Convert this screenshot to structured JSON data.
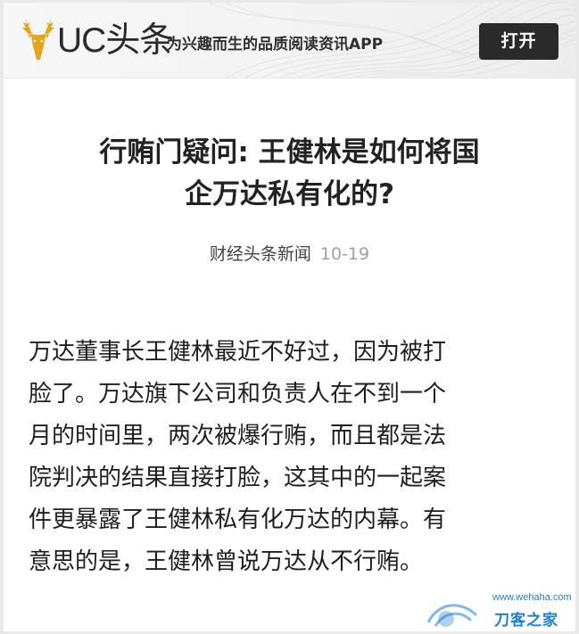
{
  "header": {
    "logo_text": "UC头条",
    "slogan": "为兴趣而生的品质阅读资讯APP",
    "open_label": "打开",
    "logo_icon": "deer-head-icon"
  },
  "article": {
    "title_lines": [
      "行贿门疑问: 王健林是如何将国",
      "企万达私有化的?"
    ],
    "source": "财经头条新闻",
    "date": "10-19",
    "body_lines": [
      "万达董事长王健林最近不好过，因为被打",
      "脸了。万达旗下公司和负责人在不到一个",
      "月的时间里，两次被爆行贿，而且都是法",
      "院判决的结果直接打脸，这其中的一起案",
      "件更暴露了王健林私有化万达的内幕。有",
      "意思的是，王健林曾说万达从不行贿。"
    ]
  },
  "watermark": {
    "url": "www.wehaha.com",
    "name": "刀客之家"
  },
  "colors": {
    "button_bg": "#2a2a2a",
    "logo_gold": "#e3a51a",
    "watermark_blue": "#1c7fd6"
  }
}
